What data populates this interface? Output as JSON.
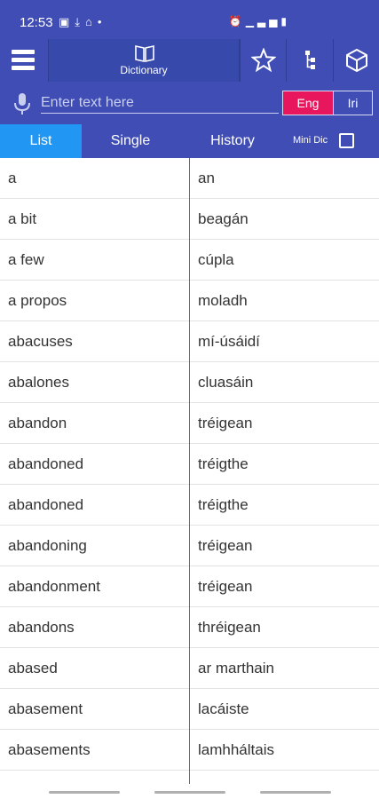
{
  "status_bar": {
    "time": "12:53",
    "icons_left": [
      "image-icon",
      "download-icon",
      "home-icon",
      "dot-icon"
    ],
    "icons_right": [
      "alarm-icon",
      "signal-icon",
      "battery-icon"
    ]
  },
  "app_bar": {
    "dictionary_label": "Dictionary",
    "icons": [
      "star-icon",
      "tree-icon",
      "cube-icon"
    ]
  },
  "search": {
    "placeholder": "Enter text here",
    "value": "",
    "lang_eng": "Eng",
    "lang_iri": "Iri",
    "active_lang": "Eng"
  },
  "tabs": {
    "list": "List",
    "single": "Single",
    "history": "History",
    "mini_dic": "Mini Dic",
    "active": "List",
    "mini_dic_checked": false
  },
  "entries": [
    {
      "en": "a",
      "ga": "an"
    },
    {
      "en": "a bit",
      "ga": "beagán"
    },
    {
      "en": "a few",
      "ga": "cúpla"
    },
    {
      "en": "a propos",
      "ga": "moladh"
    },
    {
      "en": "abacuses",
      "ga": "mí-úsáidí"
    },
    {
      "en": "abalones",
      "ga": "cluasáin"
    },
    {
      "en": "abandon",
      "ga": "tréigean"
    },
    {
      "en": "abandoned",
      "ga": "tréigthe"
    },
    {
      "en": "abandoned",
      "ga": "tréigthe"
    },
    {
      "en": "abandoning",
      "ga": "tréigean"
    },
    {
      "en": "abandonment",
      "ga": "tréigean"
    },
    {
      "en": "abandons",
      "ga": "thréigean"
    },
    {
      "en": "abased",
      "ga": "ar marthain"
    },
    {
      "en": "abasement",
      "ga": "lacáiste"
    },
    {
      "en": "abasements",
      "ga": "lamhháltais"
    }
  ],
  "colors": {
    "primary": "#3f4db5",
    "active_tab": "#2196f3",
    "active_lang": "#e8175d",
    "divider": "#2e8b7d"
  }
}
